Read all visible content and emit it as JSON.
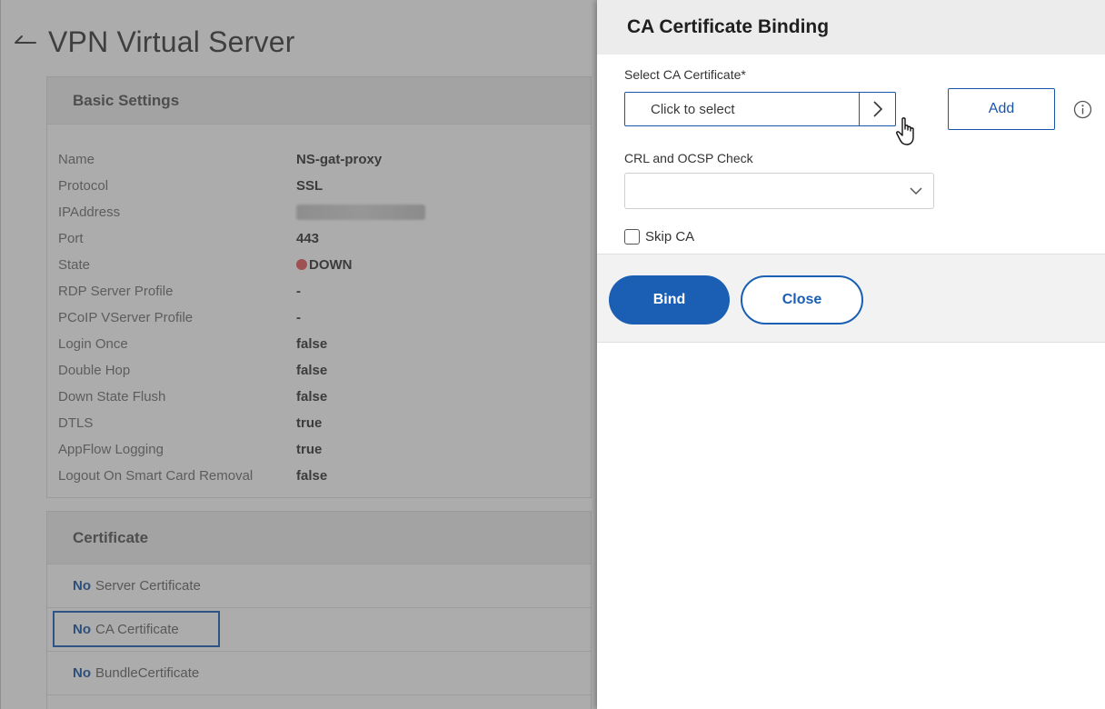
{
  "page": {
    "title": "VPN Virtual Server",
    "basic_settings": {
      "header": "Basic Settings",
      "rows": [
        {
          "label": "Name",
          "value": "NS-gat-proxy"
        },
        {
          "label": "Protocol",
          "value": "SSL"
        },
        {
          "label": "IPAddress",
          "value": ""
        },
        {
          "label": "Port",
          "value": "443"
        },
        {
          "label": "State",
          "value": "DOWN"
        },
        {
          "label": "RDP Server Profile",
          "value": "-"
        },
        {
          "label": "PCoIP VServer Profile",
          "value": "-"
        },
        {
          "label": "Login Once",
          "value": "false"
        },
        {
          "label": "Double Hop",
          "value": "false"
        },
        {
          "label": "Down State Flush",
          "value": "false"
        },
        {
          "label": "DTLS",
          "value": "true"
        },
        {
          "label": "AppFlow Logging",
          "value": "true"
        },
        {
          "label": "Logout On Smart Card Removal",
          "value": "false"
        }
      ]
    },
    "certificate": {
      "header": "Certificate",
      "rows": [
        {
          "prefix": "No",
          "label": "Server Certificate"
        },
        {
          "prefix": "No",
          "label": "CA Certificate"
        },
        {
          "prefix": "No",
          "label": "BundleCertificate"
        }
      ]
    }
  },
  "dialog": {
    "title": "CA Certificate Binding",
    "select_ca": {
      "label": "Select CA Certificate*",
      "placeholder": "Click to select"
    },
    "add_label": "Add",
    "crl": {
      "label": "CRL and OCSP Check",
      "value": ""
    },
    "skip_ca_label": "Skip CA",
    "bind_label": "Bind",
    "close_label": "Close"
  },
  "colors": {
    "accent": "#1a5fb4",
    "state_down": "#e35a5a"
  }
}
